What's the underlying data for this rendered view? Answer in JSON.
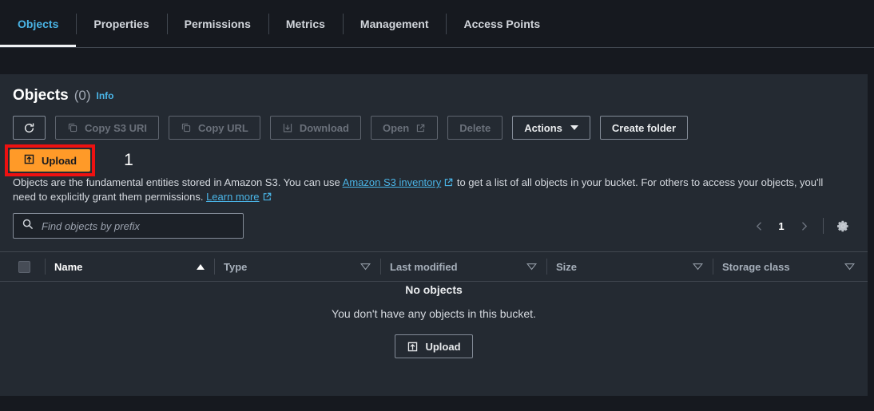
{
  "tabs": [
    {
      "label": "Objects",
      "active": true
    },
    {
      "label": "Properties",
      "active": false
    },
    {
      "label": "Permissions",
      "active": false
    },
    {
      "label": "Metrics",
      "active": false
    },
    {
      "label": "Management",
      "active": false
    },
    {
      "label": "Access Points",
      "active": false
    }
  ],
  "panel": {
    "title": "Objects",
    "count": "(0)",
    "info_label": "Info"
  },
  "toolbar": {
    "refresh_icon": "refresh-icon",
    "copy_s3_uri": "Copy S3 URI",
    "copy_url": "Copy URL",
    "download": "Download",
    "open": "Open",
    "delete": "Delete",
    "actions": "Actions",
    "create_folder": "Create folder"
  },
  "upload": {
    "label": "Upload",
    "annotation_number": "1",
    "annotation_color": "#ee1111",
    "button_color": "#ff9a28"
  },
  "description": {
    "part1": "Objects are the fundamental entities stored in Amazon S3. You can use ",
    "link1": "Amazon S3 inventory",
    "part2": " to get a list of all objects in your bucket. For others to access your objects, you'll need to explicitly grant them permissions. ",
    "link2": "Learn more"
  },
  "search": {
    "placeholder": "Find objects by prefix",
    "value": ""
  },
  "pagination": {
    "prev": "prev-page",
    "page": "1",
    "next": "next-page",
    "settings": "settings-gear"
  },
  "table": {
    "columns": [
      {
        "label": "Name",
        "sort": "asc",
        "active": true
      },
      {
        "label": "Type",
        "sort": "none",
        "active": false
      },
      {
        "label": "Last modified",
        "sort": "none",
        "active": false
      },
      {
        "label": "Size",
        "sort": "none",
        "active": false
      },
      {
        "label": "Storage class",
        "sort": "none",
        "active": false
      }
    ]
  },
  "empty_state": {
    "title": "No objects",
    "subtitle": "You don't have any objects in this bucket.",
    "button_label": "Upload"
  },
  "colors": {
    "page_background": "#16191f",
    "panel_background": "#242a32",
    "accent_link": "#4ab4e6",
    "border": "#414750",
    "annotation_red": "#ee1111",
    "upload_orange": "#ff9a28"
  }
}
